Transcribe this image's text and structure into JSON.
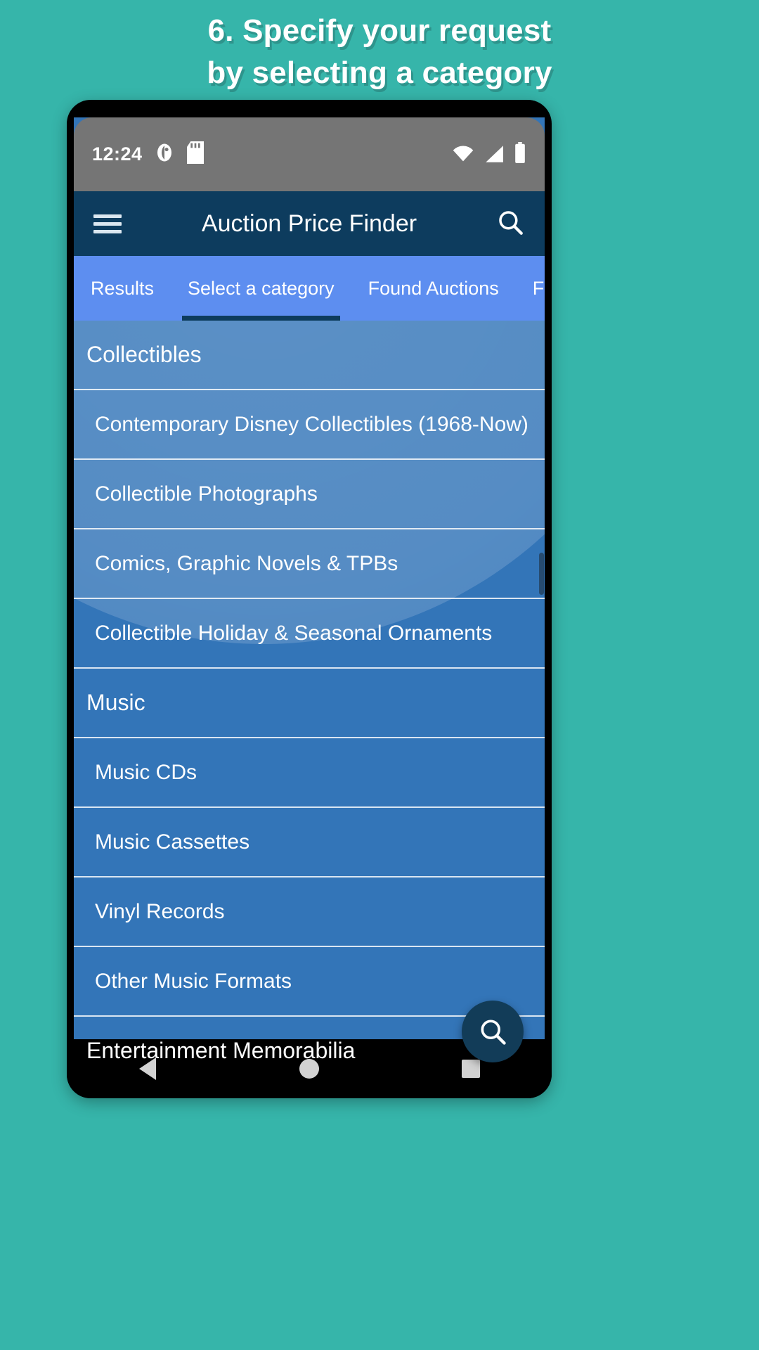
{
  "promo": {
    "line1": "6. Specify your request",
    "line2": "by selecting a category"
  },
  "colors": {
    "background": "#36b5aa",
    "appbar": "#0d3c5e",
    "tabbar": "#5d8ef0",
    "list": "#3375b8",
    "statusbar": "#757575",
    "fab": "#123c58"
  },
  "statusbar": {
    "time": "12:24",
    "icons_left": [
      "notification-icon",
      "sd-card-icon"
    ],
    "icons_right": [
      "wifi-icon",
      "cell-signal-icon",
      "battery-icon"
    ]
  },
  "appbar": {
    "menu_icon": "hamburger-menu-icon",
    "title": "Auction Price Finder",
    "search_icon": "search-icon"
  },
  "tabs": [
    {
      "label": "Results",
      "active": false
    },
    {
      "label": "Select a category",
      "active": true
    },
    {
      "label": "Found Auctions",
      "active": false
    },
    {
      "label": "Found B",
      "active": false
    }
  ],
  "list": [
    {
      "type": "header",
      "label": "Collectibles"
    },
    {
      "type": "item",
      "label": "Contemporary Disney Collectibles (1968-Now)"
    },
    {
      "type": "item",
      "label": "Collectible Photographs"
    },
    {
      "type": "item",
      "label": "Comics, Graphic Novels & TPBs"
    },
    {
      "type": "item",
      "label": "Collectible Holiday & Seasonal Ornaments"
    },
    {
      "type": "header",
      "label": "Music"
    },
    {
      "type": "item",
      "label": "Music CDs"
    },
    {
      "type": "item",
      "label": "Music Cassettes"
    },
    {
      "type": "item",
      "label": "Vinyl Records"
    },
    {
      "type": "item",
      "label": "Other Music Formats"
    },
    {
      "type": "header",
      "label": "Entertainment Memorabilia"
    }
  ],
  "fab": {
    "icon": "search-icon"
  },
  "navbar": {
    "back": "back-triangle-icon",
    "home": "home-circle-icon",
    "recents": "recents-square-icon"
  }
}
